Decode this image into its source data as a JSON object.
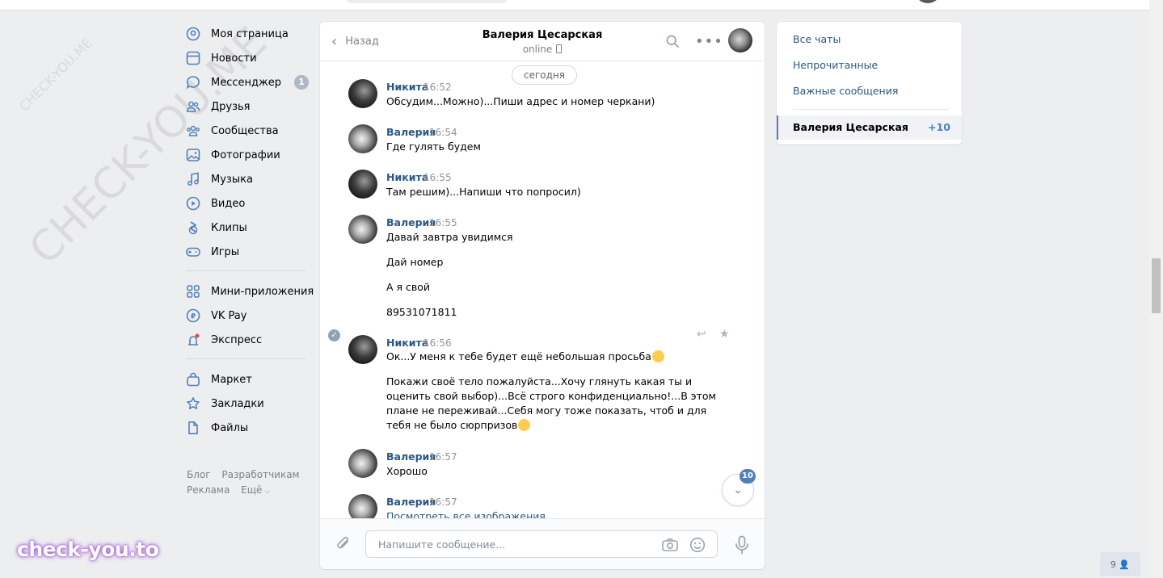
{
  "menu": {
    "items": [
      {
        "label": "Моя страница",
        "icon": "user-circle-icon"
      },
      {
        "label": "Новости",
        "icon": "news-icon"
      },
      {
        "label": "Мессенджер",
        "icon": "message-icon",
        "badge": "1"
      },
      {
        "label": "Друзья",
        "icon": "friends-icon"
      },
      {
        "label": "Сообщества",
        "icon": "communities-icon"
      },
      {
        "label": "Фотографии",
        "icon": "photos-icon"
      },
      {
        "label": "Музыка",
        "icon": "music-icon"
      },
      {
        "label": "Видео",
        "icon": "video-icon"
      },
      {
        "label": "Клипы",
        "icon": "clips-icon"
      },
      {
        "label": "Игры",
        "icon": "games-icon"
      },
      {
        "label": "Мини-приложения",
        "icon": "mini-apps-icon"
      },
      {
        "label": "VK Pay",
        "icon": "vk-pay-icon"
      },
      {
        "label": "Экспресс",
        "icon": "express-icon"
      },
      {
        "label": "Маркет",
        "icon": "market-icon"
      },
      {
        "label": "Закладки",
        "icon": "bookmarks-icon"
      },
      {
        "label": "Файлы",
        "icon": "files-icon"
      }
    ],
    "footer": {
      "blog": "Блог",
      "developers": "Разработчикам",
      "ads": "Реклама",
      "more": "Ещё"
    }
  },
  "chat": {
    "back_label": "Назад",
    "contact_name": "Валерия Цесарская",
    "status": "online",
    "date_pill": "сегодня",
    "messages": [
      {
        "author": "Никита",
        "time": "16:52",
        "lines": [
          "Обсудим...Можно)...Пиши адрес и номер черкани)"
        ]
      },
      {
        "author": "Валерия",
        "time": "16:54",
        "lines": [
          "Где гулять будем"
        ]
      },
      {
        "author": "Никита",
        "time": "16:55",
        "lines": [
          "Там решим)...Напиши что попросил)"
        ]
      },
      {
        "author": "Валерия",
        "time": "16:55",
        "lines": [
          "Давай завтра увидимся",
          "Дай номер",
          "А я свой",
          "89531071811"
        ]
      },
      {
        "author": "Никита",
        "time": "16:56",
        "lines": [
          "Ок...У меня к тебе будет ещё небольшая просьба",
          "Покажи своё тело пожалуйста...Хочу глянуть какая ты и",
          "оценить свой выбор)...Всё строго конфиденциально!...В этом",
          "плане не переживай...Себя могу тоже показать, чтоб и для",
          "тебя не было сюрпризов"
        ]
      },
      {
        "author": "Валерия",
        "time": "16:57",
        "lines": [
          "Хорошо"
        ]
      },
      {
        "author": "Валерия",
        "time": "16:57",
        "lines": [
          "Посмотреть все изображения"
        ]
      }
    ],
    "unread_badge": "10",
    "composer_placeholder": "Напишите сообщение..."
  },
  "right_panel": {
    "all_chats": "Все чаты",
    "unread": "Непрочитанные",
    "important": "Важные сообщения",
    "active_chat": {
      "name": "Валерия Цесарская",
      "count": "+10"
    }
  },
  "watermarks": {
    "small": "CHECK-YOU.ME",
    "large": "CHECK-YOU.ME",
    "logo": "check-you.to"
  },
  "online_counter": "9",
  "colors": {
    "link": "#2a5885",
    "accent": "#5181b8",
    "background": "#edeef0"
  }
}
